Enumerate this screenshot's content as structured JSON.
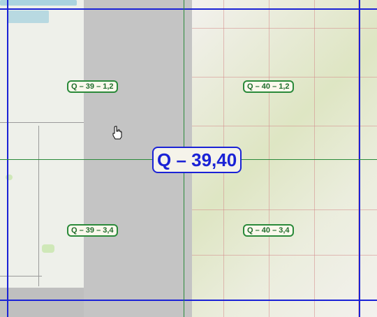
{
  "map": {
    "grid_major_label": "Q – 39,40",
    "sheets": [
      {
        "id": "q39-12",
        "label": "Q – 39 – 1,2"
      },
      {
        "id": "q40-12",
        "label": "Q – 40 – 1,2"
      },
      {
        "id": "q39-34",
        "label": "Q – 39 – 3,4"
      },
      {
        "id": "q40-34",
        "label": "Q – 40 – 3,4"
      }
    ],
    "colors": {
      "major_grid": "#1a22d6",
      "minor_grid": "#2a8a3a",
      "label_text": "#1f6d2c"
    },
    "cursor": "hand-pointer-icon"
  }
}
